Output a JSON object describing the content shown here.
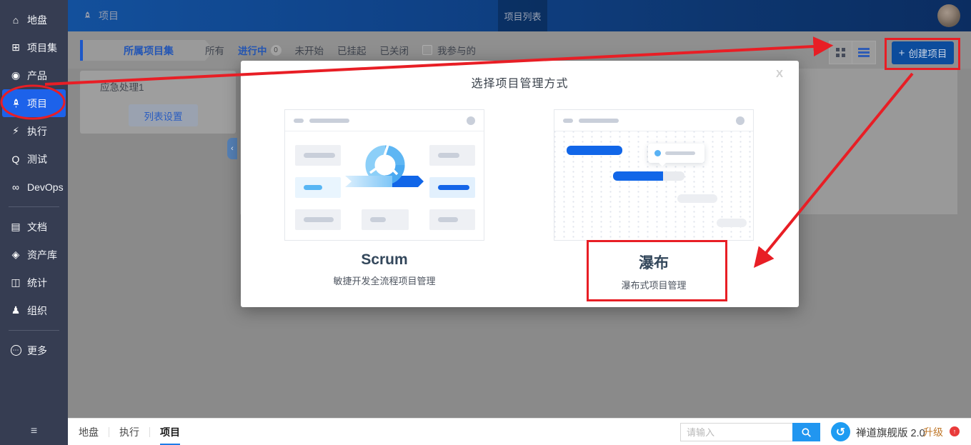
{
  "colors": {
    "sidebar_bg": "#363d52",
    "sidebar_active": "#1d62ea",
    "topbar_blue": "#0f4287",
    "accent_blue": "#1465e8",
    "annotation_red": "#e81e25",
    "search_button_blue": "#2196f0"
  },
  "icons": {
    "home-icon": "⌂",
    "program-icon": "⊞",
    "product-icon": "◉",
    "execution-icon": "⚡",
    "test-icon": "Q",
    "devops-icon": "∞",
    "doc-icon": "▤",
    "asset-icon": "◈",
    "stats-icon": "◫",
    "org-icon": "♟",
    "more-dots": "⋯",
    "menu-collapse": "≡",
    "panel-collapse": "‹",
    "plus": "+",
    "logo-swirl": "↺",
    "upgrade-arrow": "↑"
  },
  "sidebar": {
    "items": [
      {
        "label": "地盘",
        "icon": "home-icon"
      },
      {
        "label": "项目集",
        "icon": "program-icon"
      },
      {
        "label": "产品",
        "icon": "product-icon"
      },
      {
        "label": "项目",
        "icon": "rocket-icon",
        "active": true
      },
      {
        "label": "执行",
        "icon": "execution-icon"
      },
      {
        "label": "测试",
        "icon": "test-icon"
      },
      {
        "label": "DevOps",
        "icon": "devops-icon"
      },
      {
        "label": "文档",
        "icon": "doc-icon"
      },
      {
        "label": "资产库",
        "icon": "asset-icon"
      },
      {
        "label": "统计",
        "icon": "stats-icon"
      },
      {
        "label": "组织",
        "icon": "org-icon"
      },
      {
        "label": "更多",
        "icon": "more-dots"
      }
    ]
  },
  "topbar": {
    "title": "项目",
    "active_tab": "项目列表"
  },
  "filterbar": {
    "project_set_crumb": "所属项目集",
    "filters": [
      "所有",
      "进行中",
      "未开始",
      "已挂起",
      "已关闭"
    ],
    "running_badge": "0",
    "participate_label": "我参与的",
    "create_label": "创建项目"
  },
  "panel": {
    "project_set_name": "应急处理1",
    "list_settings_label": "列表设置"
  },
  "modal": {
    "title": "选择项目管理方式",
    "close_label": "X",
    "scrum": {
      "name": "Scrum",
      "desc": "敏捷开发全流程项目管理"
    },
    "waterfall": {
      "name": "瀑布",
      "desc": "瀑布式项目管理"
    }
  },
  "footer": {
    "tabs": [
      "地盘",
      "执行",
      "项目"
    ],
    "active_tab": "项目",
    "search_placeholder": "请输入",
    "brand": "禅道旗舰版 2.0",
    "upgrade_label": "升级"
  }
}
